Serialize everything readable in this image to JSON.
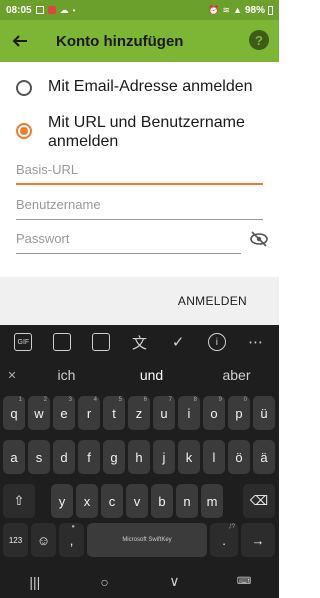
{
  "status": {
    "time": "08:05",
    "battery": "98%"
  },
  "appbar": {
    "title": "Konto hinzufügen",
    "help": "?"
  },
  "options": [
    {
      "label": "Mit Email-Adresse anmelden",
      "checked": false
    },
    {
      "label": "Mit URL und Benutzername anmelden",
      "checked": true
    }
  ],
  "fields": {
    "base_url_placeholder": "Basis-URL",
    "username_placeholder": "Benutzername",
    "password_placeholder": "Passwort"
  },
  "action": {
    "signin_label": "ANMELDEN"
  },
  "keyboard": {
    "toolbar": [
      "GIF",
      "sticker",
      "clipboard",
      "translate",
      "check",
      "info",
      "more"
    ],
    "suggestions": [
      "ich",
      "und",
      "aber"
    ],
    "row1": [
      "q",
      "w",
      "e",
      "r",
      "t",
      "z",
      "u",
      "i",
      "o",
      "p",
      "ü"
    ],
    "row1_hints": [
      "1",
      "2",
      "3",
      "4",
      "5",
      "6",
      "7",
      "8",
      "9",
      "0",
      ""
    ],
    "row2": [
      "a",
      "s",
      "d",
      "f",
      "g",
      "h",
      "j",
      "k",
      "l",
      "ö",
      "ä"
    ],
    "row3": [
      "y",
      "x",
      "c",
      "v",
      "b",
      "n",
      "m"
    ],
    "num_key": "123",
    "comma": ",",
    "space_label": "Microsoft SwiftKey",
    "period": ".",
    "period_hint": ",!?"
  },
  "colors": {
    "appbar": "#7db534",
    "statusbar": "#6ba02d",
    "accent": "#f07c2a"
  }
}
